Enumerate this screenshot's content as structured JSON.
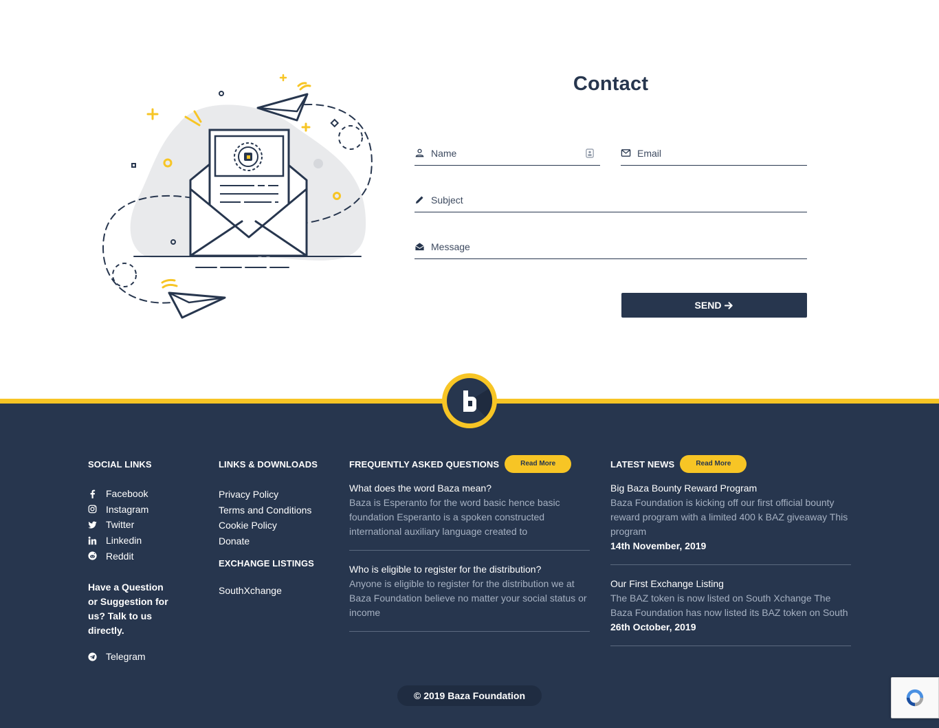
{
  "contact": {
    "title": "Contact",
    "name_placeholder": "Name",
    "email_placeholder": "Email",
    "subject_placeholder": "Subject",
    "message_placeholder": "Message",
    "send_label": "SEND"
  },
  "footer": {
    "social": {
      "title": "SOCIAL LINKS",
      "items": [
        {
          "label": "Facebook",
          "icon": "facebook-icon"
        },
        {
          "label": "Instagram",
          "icon": "instagram-icon"
        },
        {
          "label": "Twitter",
          "icon": "twitter-icon"
        },
        {
          "label": "Linkedin",
          "icon": "linkedin-icon"
        },
        {
          "label": "Reddit",
          "icon": "reddit-icon"
        }
      ],
      "question": "Have a Question or Suggestion for us? Talk to us directly.",
      "telegram": "Telegram"
    },
    "links": {
      "title": "LINKS & DOWNLOADS",
      "items": [
        "Privacy Policy",
        "Terms and Conditions",
        "Cookie Policy",
        "Donate"
      ],
      "exchange_title": "EXCHANGE LISTINGS",
      "exchange_items": [
        "SouthXchange"
      ]
    },
    "faq": {
      "title": "FREQUENTLY ASKED QUESTIONS",
      "read_more": "Read More",
      "items": [
        {
          "question": "What does the word Baza mean?",
          "answer": "Baza is Esperanto for the word basic hence basic foundation Esperanto is a spoken constructed international auxiliary language created to"
        },
        {
          "question": "Who is eligible to register for the distribution?",
          "answer": "Anyone is eligible to register for the distribution we at Baza Foundation believe no matter your social status or income"
        }
      ]
    },
    "news": {
      "title": "LATEST NEWS",
      "read_more": "Read More",
      "items": [
        {
          "title": "Big Baza Bounty Reward Program",
          "summary": "Baza Foundation is kicking off our first official bounty reward program with a limited 400 k BAZ giveaway This program",
          "date": "14th November, 2019"
        },
        {
          "title": "Our First Exchange Listing",
          "summary": "The BAZ token is now listed on South Xchange The Baza Foundation has now listed its BAZ token on South",
          "date": "26th October, 2019"
        }
      ]
    },
    "copyright": "© 2019 Baza Foundation"
  },
  "colors": {
    "navy": "#27364e",
    "yellow": "#f7c525",
    "muted_text": "#a6b1c2"
  }
}
